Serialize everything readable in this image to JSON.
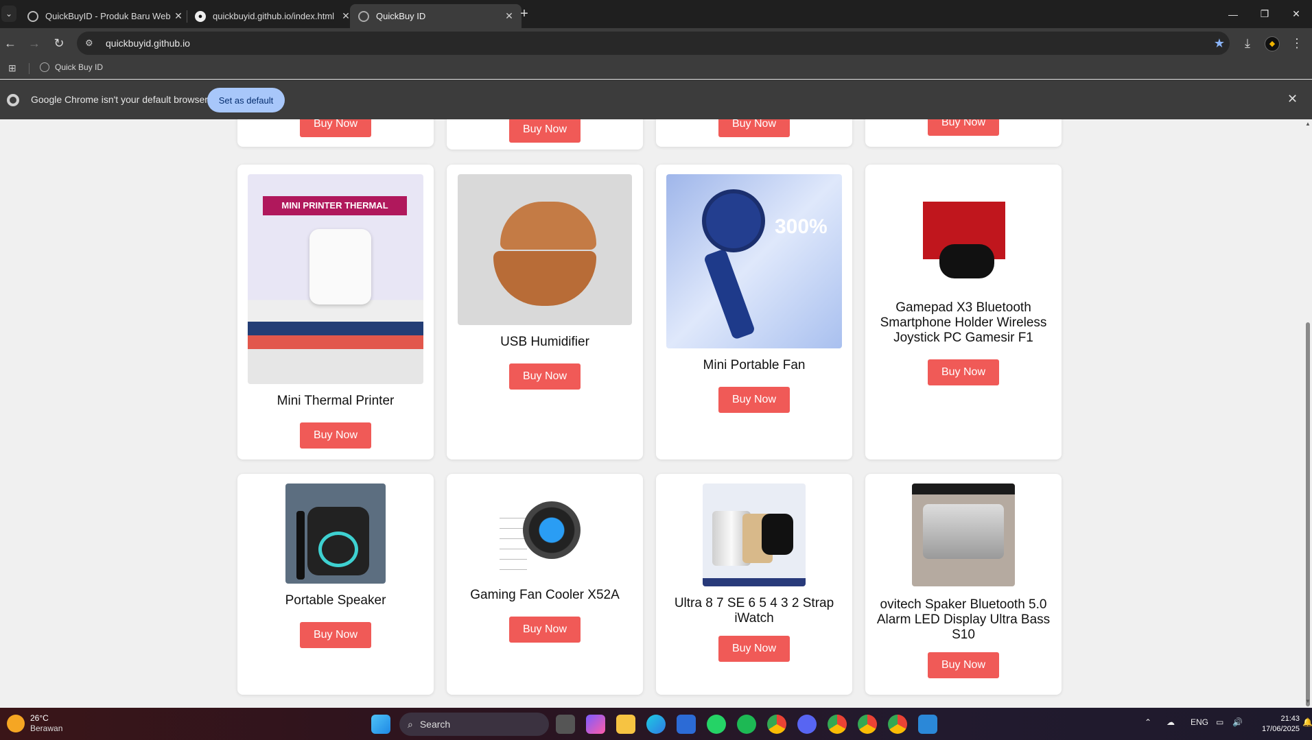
{
  "tabs": [
    {
      "title": "QuickBuyID - Produk Baru Web",
      "favicon": "globe-icon"
    },
    {
      "title": "quickbuyid.github.io/index.html",
      "favicon": "github-icon"
    },
    {
      "title": "QuickBuy ID",
      "favicon": "globe-icon"
    }
  ],
  "toolbar": {
    "url": "quickbuyid.github.io"
  },
  "bookmarks": {
    "item": "Quick Buy ID"
  },
  "infobar": {
    "message": "Google Chrome isn't your default browser",
    "button": "Set as default"
  },
  "products": {
    "buy_label": "Buy Now",
    "row2": [
      {
        "name": "Mini Thermal Printer",
        "image_text": "MINI PRINTER THERMAL"
      },
      {
        "name": "USB Humidifier"
      },
      {
        "name": "Mini Portable Fan",
        "image_text": "300%"
      },
      {
        "name": "Gamepad X3 Bluetooth Smartphone Holder Wireless Joystick PC Gamesir F1"
      }
    ],
    "row3": [
      {
        "name": "Portable Speaker"
      },
      {
        "name": "Gaming Fan Cooler X52A"
      },
      {
        "name": "Ultra 8 7 SE 6 5 4 3 2 Strap iWatch"
      },
      {
        "name": "ovitech Spaker Bluetooth 5.0 Alarm LED Display Ultra Bass S10"
      }
    ]
  },
  "taskbar": {
    "weather_temp": "26°C",
    "weather_cond": "Berawan",
    "search": "Search",
    "lang": "ENG",
    "time": "21:43",
    "date": "17/06/2025"
  }
}
